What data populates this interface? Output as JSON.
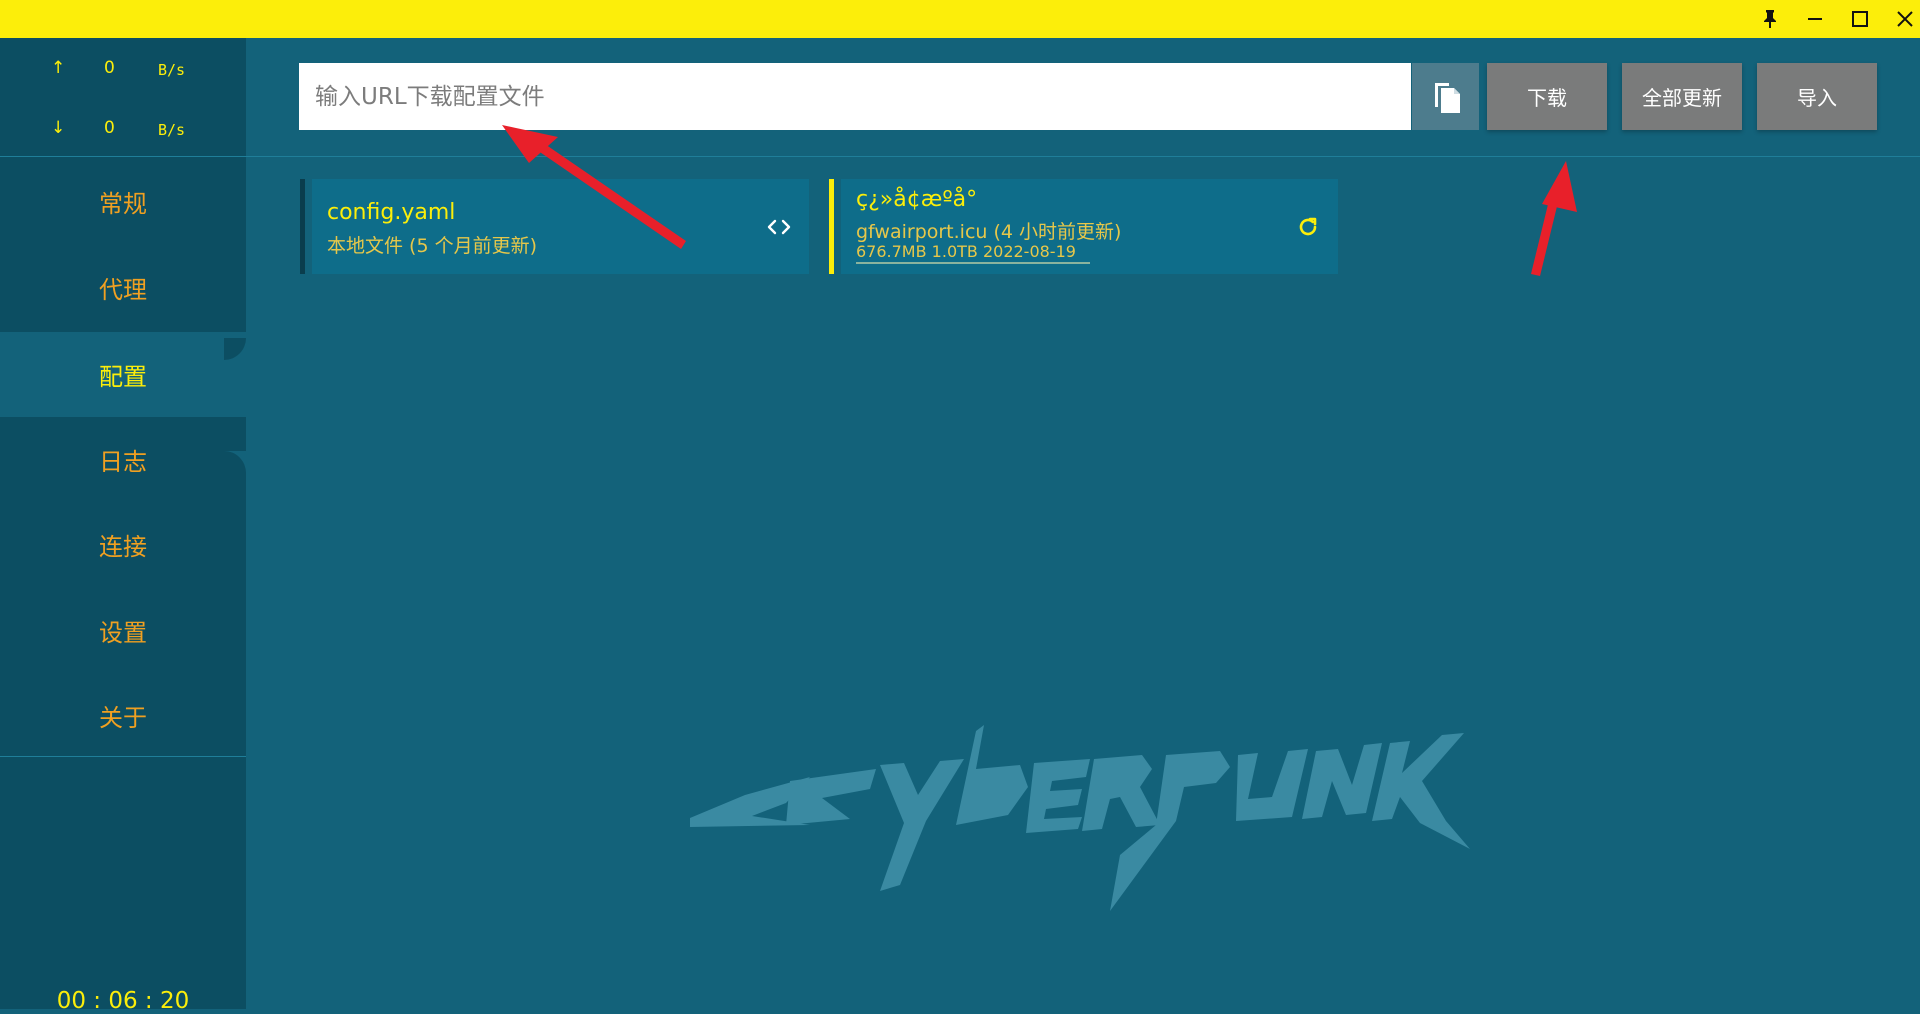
{
  "window": {
    "controls": [
      "pin-icon",
      "minimize-icon",
      "maximize-icon",
      "close-icon"
    ]
  },
  "traffic": {
    "up_arrow": "↑",
    "up_value": "0",
    "up_unit": "B/s",
    "down_arrow": "↓",
    "down_value": "0",
    "down_unit": "B/s"
  },
  "nav": {
    "items": [
      {
        "label": "常规"
      },
      {
        "label": "代理"
      },
      {
        "label": "配置"
      },
      {
        "label": "日志"
      },
      {
        "label": "连接"
      },
      {
        "label": "设置"
      },
      {
        "label": "关于"
      }
    ],
    "active": "配置"
  },
  "timer": "00 : 06 : 20",
  "toolbar": {
    "url_placeholder": "输入URL下载配置文件",
    "url_value": "",
    "paste_icon": "paste-icon",
    "download_label": "下载",
    "update_all_label": "全部更新",
    "import_label": "导入"
  },
  "profiles": [
    {
      "title": "config.yaml",
      "subtitle": "本地文件 (5 个月前更新)",
      "icon": "code-icon",
      "selected": false
    },
    {
      "title": "ç¿»å¢æºå°",
      "subtitle": "gfwairport.icu (4 小时前更新)",
      "usage": "676.7MB   1.0TB   2022-08-19",
      "icon": "refresh-icon",
      "selected": true
    }
  ],
  "colors": {
    "accent_yellow": "#fcee0a",
    "nav_text": "#f0a021",
    "sidebar_bg": "#0c4e62",
    "main_bg": "#13627a",
    "card_bg": "#0e6d8a",
    "button_gray": "#7a7b7b",
    "arrow_red": "#e8202a"
  },
  "watermark_logo": "Cyberpunk"
}
